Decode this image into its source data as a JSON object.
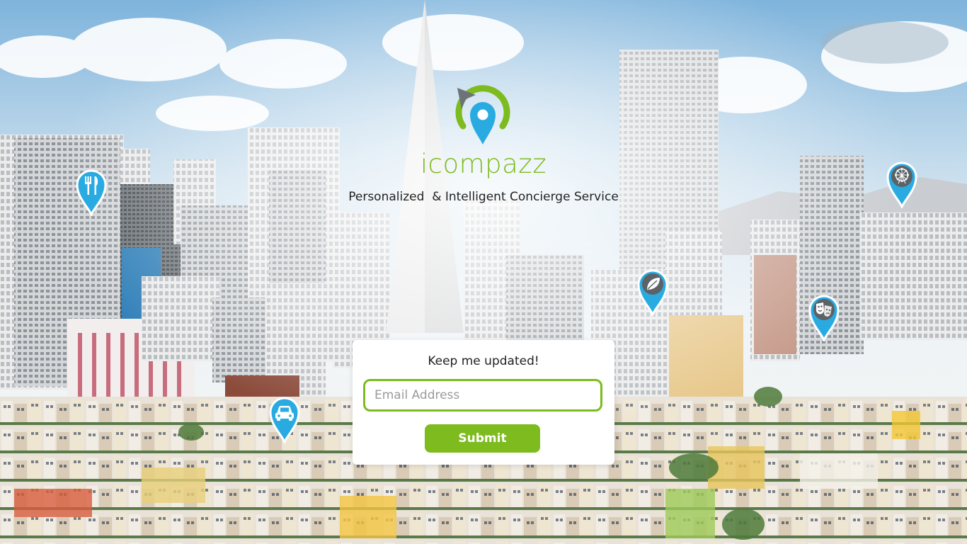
{
  "brand": {
    "name": "icompazz",
    "tagline": "Personalized  & Intelligent Concierge Service"
  },
  "signup": {
    "title": "Keep me updated!",
    "email_placeholder": "Email Address",
    "submit_label": "Submit"
  },
  "colors": {
    "brand_green": "#7dbb1f",
    "pin_blue": "#29abe2",
    "pin_border": "#ffffff"
  },
  "pins": [
    {
      "icon": "restaurant-icon"
    },
    {
      "icon": "car-icon"
    },
    {
      "icon": "leaf-icon"
    },
    {
      "icon": "theater-masks-icon"
    },
    {
      "icon": "ferris-wheel-icon"
    }
  ]
}
